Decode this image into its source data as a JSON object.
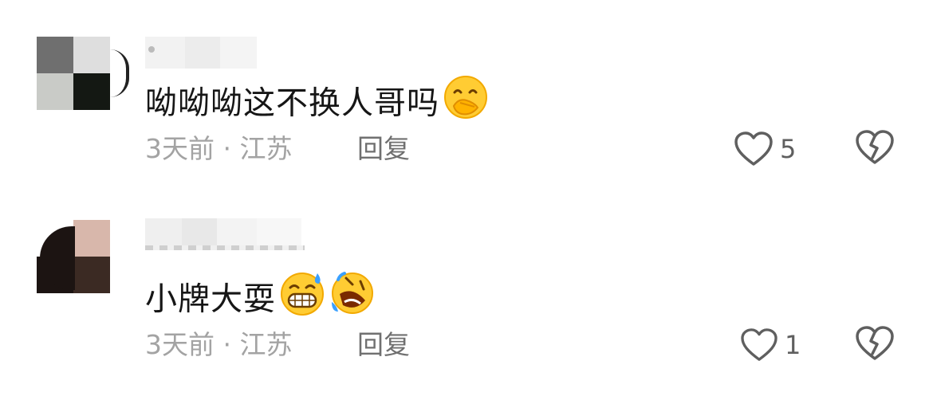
{
  "comments": [
    {
      "text": "呦呦呦这不换人哥吗",
      "emojis": [
        "hand-over-mouth-emoji"
      ],
      "time_location": "3天前 · 江苏",
      "reply_label": "回复",
      "like_count": "5"
    },
    {
      "text": "小牌大耍",
      "emojis": [
        "grinning-sweat-emoji",
        "rolling-on-floor-laughing-emoji"
      ],
      "time_location": "3天前 · 江苏",
      "reply_label": "回复",
      "like_count": "1"
    }
  ],
  "icons": {
    "like": "heart-outline-icon",
    "dislike": "broken-heart-icon"
  },
  "colors": {
    "text": "#161616",
    "meta": "#a3a3a3",
    "reply": "#707070",
    "icon": "#5f5f5f",
    "emoji_face": "#ffcc33"
  }
}
